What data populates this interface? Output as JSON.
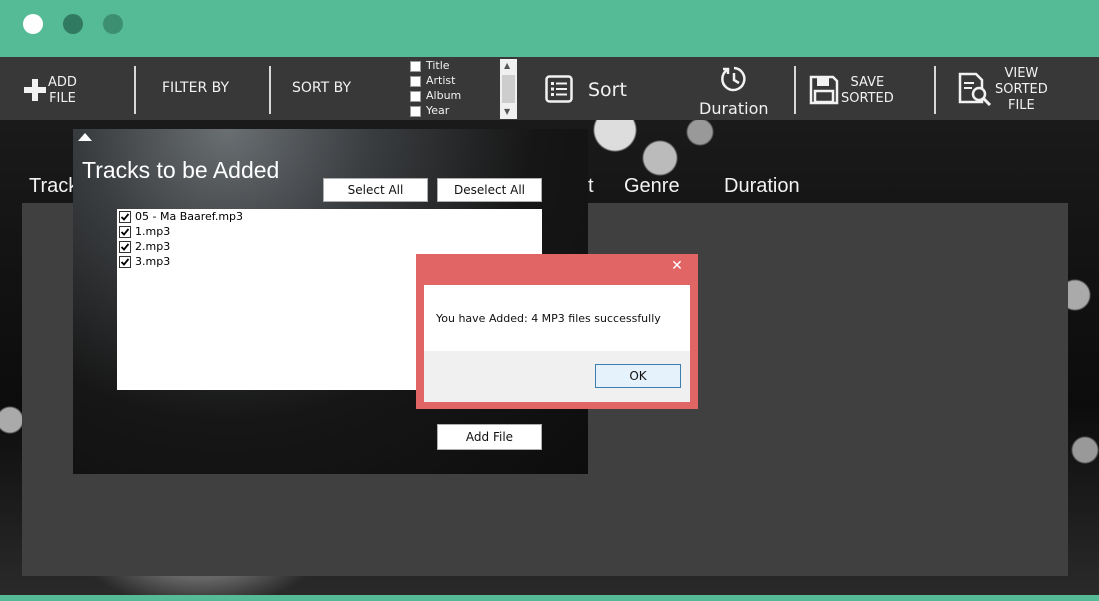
{
  "window": {
    "controls": [
      "close-dot",
      "minimize-dot",
      "maximize-dot"
    ]
  },
  "toolbar": {
    "add_file": "ADD\nFILE",
    "filter_by": "FILTER BY",
    "sort_by": "SORT BY",
    "sort_fields": [
      "Title",
      "Artist",
      "Album",
      "Year"
    ],
    "sort": "Sort",
    "duration": "Duration",
    "save_sorted": "SAVE\nSORTED",
    "view_sorted_file": "VIEW\nSORTED\nFILE"
  },
  "columns": {
    "track": "Track",
    "artist_partial": "t",
    "genre": "Genre",
    "duration": "Duration"
  },
  "tracks_dialog": {
    "title": "Tracks to be Added",
    "select_all": "Select All",
    "deselect_all": "Deselect All",
    "tracks": [
      "05 - Ma Baaref.mp3",
      "1.mp3",
      "2.mp3",
      "3.mp3"
    ],
    "add_file": "Add File"
  },
  "message_box": {
    "close": "✕",
    "message": "You have Added: 4 MP3 files successfully",
    "ok": "OK"
  },
  "colors": {
    "accent": "#55bb96",
    "toolbar": "#383838",
    "panel": "#404040",
    "msg_frame": "#e26565"
  }
}
